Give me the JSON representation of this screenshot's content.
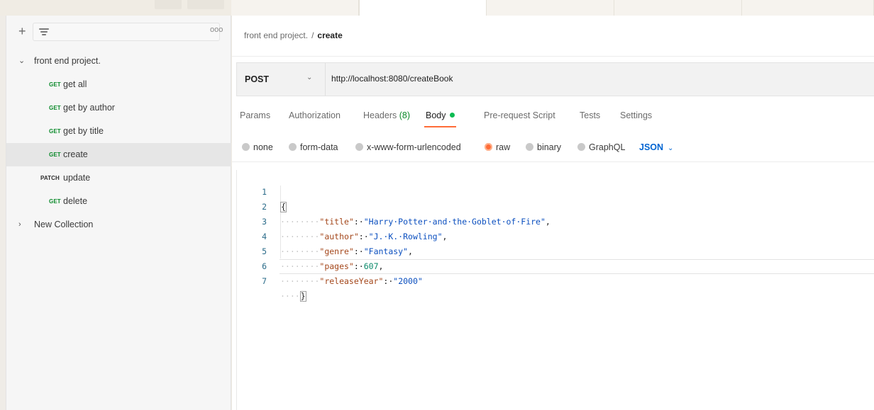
{
  "sidebar": {
    "more_label": "ooo",
    "collections": [
      {
        "name": "front end project.",
        "expanded": true,
        "requests": [
          {
            "method": "GET",
            "name": "get all"
          },
          {
            "method": "GET",
            "name": "get by author"
          },
          {
            "method": "GET",
            "name": "get by title"
          },
          {
            "method": "GET",
            "name": "create",
            "selected": true
          },
          {
            "method": "PATCH",
            "name": "update"
          },
          {
            "method": "GET",
            "name": "delete"
          }
        ]
      },
      {
        "name": "New Collection",
        "expanded": false
      }
    ]
  },
  "breadcrumb": {
    "parent": "front end project.",
    "separator": "/",
    "current": "create"
  },
  "request": {
    "method": "POST",
    "url": "http://localhost:8080/createBook"
  },
  "request_tabs": [
    {
      "label": "Params"
    },
    {
      "label": "Authorization"
    },
    {
      "label": "Headers",
      "count": "(8)"
    },
    {
      "label": "Body",
      "active": true,
      "indicator": "green-dot"
    },
    {
      "label": "Pre-request Script"
    },
    {
      "label": "Tests"
    },
    {
      "label": "Settings"
    }
  ],
  "body_types": {
    "options": [
      "none",
      "form-data",
      "x-www-form-urlencoded",
      "raw",
      "binary",
      "GraphQL"
    ],
    "selected": "raw",
    "format": "JSON"
  },
  "editor": {
    "line_numbers": [
      "1",
      "2",
      "3",
      "4",
      "5",
      "6",
      "7"
    ],
    "lines": [
      {
        "indent": "",
        "key": "",
        "colon": "",
        "value": "",
        "comma": "",
        "brace": "{"
      },
      {
        "indent": "········",
        "key": "\"title\"",
        "colon": ":·",
        "value": "\"Harry·Potter·and·the·Goblet·of·Fire\"",
        "comma": ","
      },
      {
        "indent": "········",
        "key": "\"author\"",
        "colon": ":·",
        "value": "\"J.·K.·Rowling\"",
        "comma": ","
      },
      {
        "indent": "········",
        "key": "\"genre\"",
        "colon": ":·",
        "value": "\"Fantasy\"",
        "comma": ","
      },
      {
        "indent": "········",
        "key": "\"pages\"",
        "colon": ":·",
        "value": "607",
        "comma": ",",
        "value_type": "number"
      },
      {
        "indent": "········",
        "key": "\"releaseYear\"",
        "colon": ":·",
        "value": "\"2000\"",
        "comma": ""
      },
      {
        "indent": "····",
        "key": "",
        "colon": "",
        "value": "",
        "comma": "",
        "brace": "}"
      }
    ]
  },
  "colors": {
    "accent": "#ff6c37",
    "get_method": "#0a8a2a",
    "json_format": "#0265d2",
    "body_indicator": "#0cbb52"
  }
}
